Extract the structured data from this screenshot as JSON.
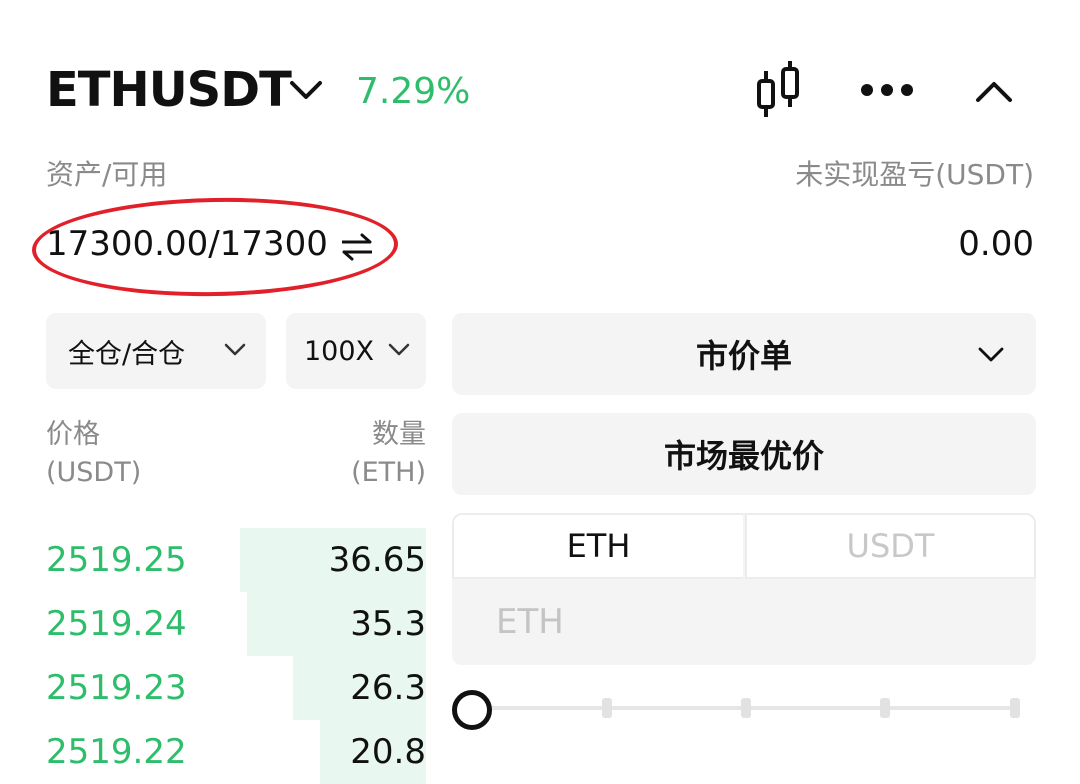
{
  "header": {
    "symbol": "ETHUSDT",
    "change": "7.29%",
    "colors": {
      "up": "#2ebd6b",
      "text": "#111111",
      "muted": "#8a8a8a",
      "annotation": "#e2202a"
    },
    "icons": [
      "chevron-down-icon",
      "candlestick-chart-icon",
      "more-icon",
      "chevron-up-icon"
    ]
  },
  "assets": {
    "label": "资产/可用",
    "value": "17300.00/17300",
    "pnl_label": "未实现盈亏(USDT)",
    "pnl_value": "0.00"
  },
  "controls": {
    "margin_mode": "全仓/合仓",
    "leverage": "100X",
    "order_type": "市价单",
    "best_price": "市场最优价",
    "unit_tabs": [
      "ETH",
      "USDT"
    ],
    "amount_placeholder": "ETH"
  },
  "orderbook": {
    "price_header": "价格",
    "price_unit": "(USDT)",
    "qty_header": "数量",
    "qty_unit": "(ETH)",
    "rows": [
      {
        "price": "2519.25",
        "qty": "36.65",
        "depth_fraction": 0.49
      },
      {
        "price": "2519.24",
        "qty": "35.3",
        "depth_fraction": 0.47
      },
      {
        "price": "2519.23",
        "qty": "26.3",
        "depth_fraction": 0.35
      },
      {
        "price": "2519.22",
        "qty": "20.8",
        "depth_fraction": 0.28
      }
    ]
  }
}
